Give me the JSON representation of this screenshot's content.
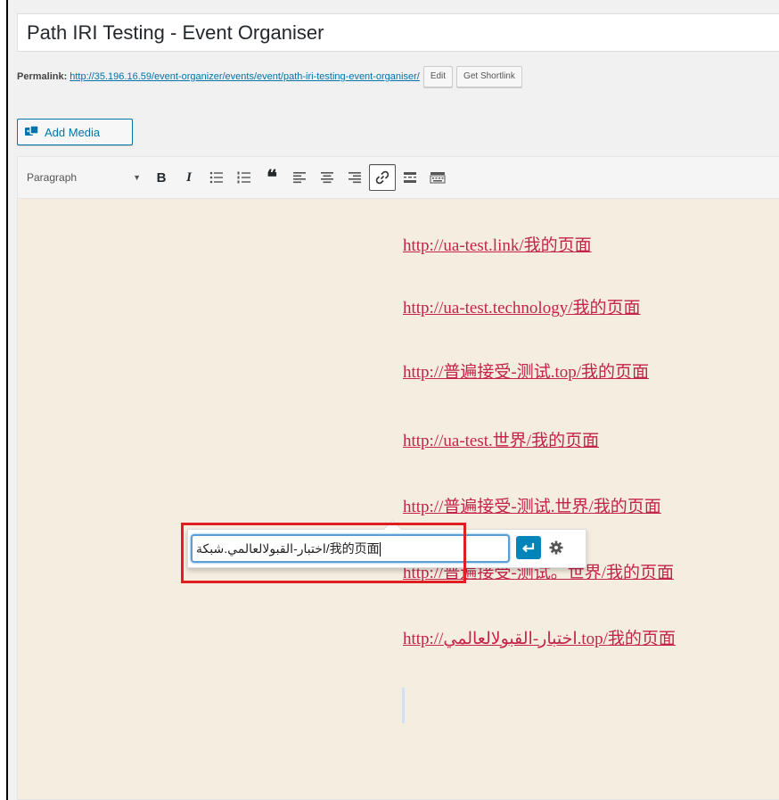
{
  "post": {
    "title": "Path IRI Testing - Event Organiser"
  },
  "permalink": {
    "label": "Permalink:",
    "url": "http://35.196.16.59/event-organizer/events/event/path-iri-testing-event-organiser/",
    "edit_label": "Edit",
    "shortlink_label": "Get Shortlink"
  },
  "media": {
    "add_media_label": "Add Media"
  },
  "toolbar": {
    "format_value": "Paragraph",
    "icons": [
      "bold-icon",
      "italic-icon",
      "bulleted-list-icon",
      "numbered-list-icon",
      "blockquote-icon",
      "align-left-icon",
      "align-center-icon",
      "align-right-icon",
      "link-icon",
      "read-more-icon",
      "toolbar-toggle-icon"
    ],
    "active": "link-icon"
  },
  "content": {
    "links": [
      "http://ua-test.link/我的页面",
      "http://ua-test.technology/我的页面",
      "http://普遍接受-测试.top/我的页面",
      "http://ua-test.世界/我的页面",
      "http://普遍接受-测试.世界/我的页面",
      "http://普遍接受-测试。世界/我的页面",
      "http://اختبار-القبولالعالمي.top/我的页面"
    ]
  },
  "link_popup": {
    "url_value": "اختبار-القبولالعالمي.شبكة/我的页面"
  },
  "colors": {
    "link": "#c4234a",
    "content_bg": "#f4ede0",
    "highlight": "#e02020",
    "accent": "#0085ba"
  }
}
